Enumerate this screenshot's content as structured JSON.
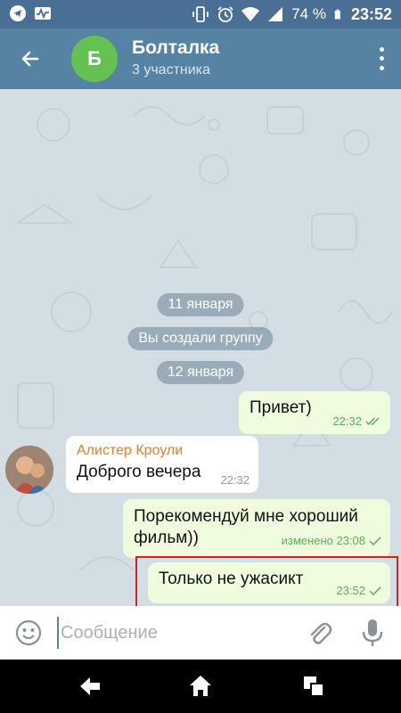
{
  "status_bar": {
    "battery": "74 %",
    "time": "23:52"
  },
  "header": {
    "avatar_letter": "Б",
    "title": "Болталка",
    "subtitle": "3 участника"
  },
  "messages": {
    "date1": "11 января",
    "service": "Вы создали группу",
    "date2": "12 января",
    "m1": {
      "text": "Привет)",
      "time": "22:32"
    },
    "m2": {
      "sender": "Алистер Кроули",
      "text": "Доброго вечера",
      "time": "22:32"
    },
    "m3": {
      "text": "Порекомендуй мне хороший фильм))",
      "meta": "изменено 23:08"
    },
    "m4": {
      "text": "Только не ужасикт",
      "time": "23:52"
    }
  },
  "input": {
    "placeholder": "Сообщение"
  },
  "colors": {
    "header": "#5682a3",
    "statusbar": "#4a6f94",
    "outgoing_bubble": "#effdde",
    "incoming_bubble": "#ffffff",
    "highlight": "#d52020",
    "sender_name": "#e67e22"
  },
  "icons": {
    "status_left": [
      "telegram-icon",
      "activity-icon"
    ],
    "status_right": [
      "vibrate-icon",
      "alarm-icon",
      "wifi-icon",
      "signal-icon",
      "battery-icon"
    ],
    "nav": [
      "back-nav-icon",
      "home-icon",
      "recents-icon"
    ]
  }
}
